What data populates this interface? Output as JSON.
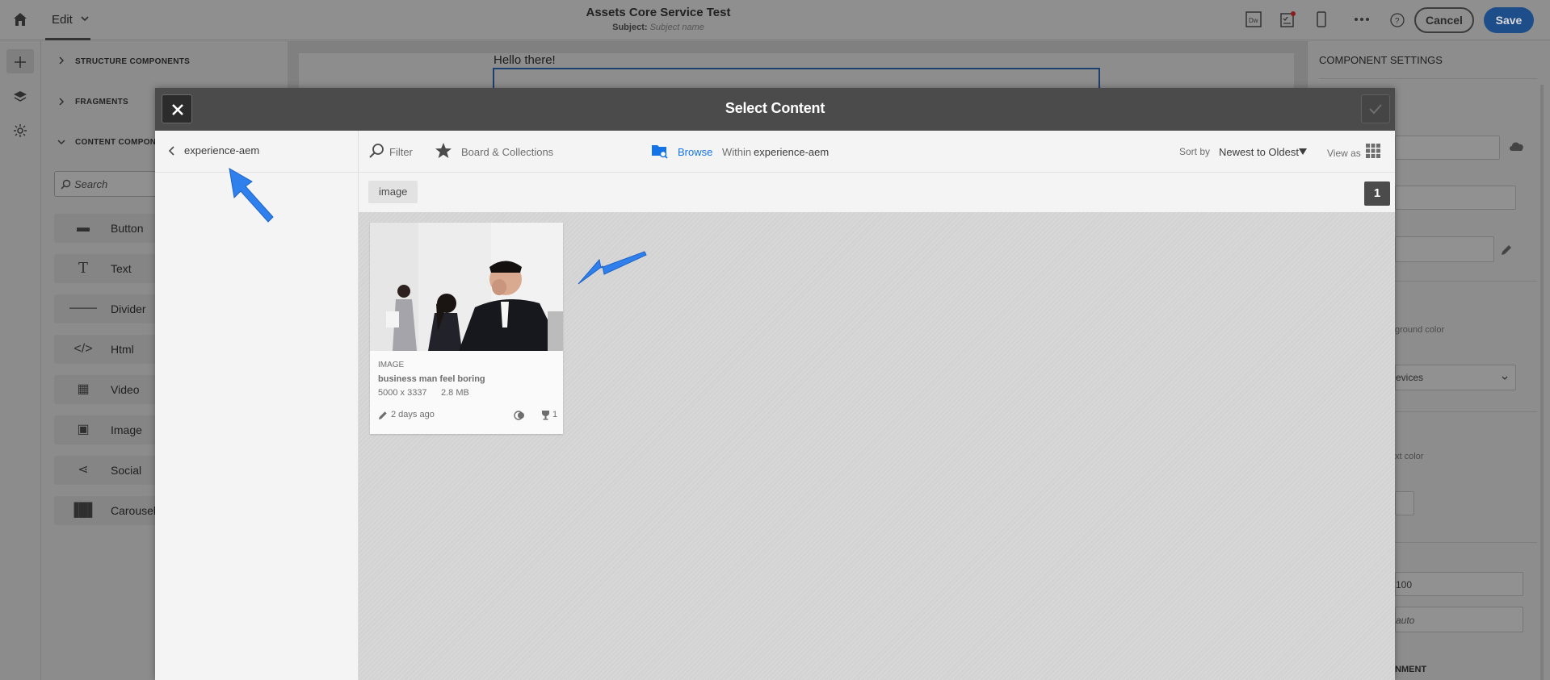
{
  "app": {
    "mode_label": "Edit",
    "title": "Assets Core Service Test",
    "subject_label": "Subject:",
    "subject_placeholder": "Subject name",
    "cancel_label": "Cancel",
    "save_label": "Save"
  },
  "left_panel": {
    "sections": [
      {
        "label": "STRUCTURE COMPONENTS",
        "expanded": false
      },
      {
        "label": "FRAGMENTS",
        "expanded": false
      },
      {
        "label": "CONTENT COMPONENTS",
        "expanded": true
      }
    ],
    "search_placeholder": "Search",
    "components": [
      {
        "label": "Button",
        "icon": "button-icon"
      },
      {
        "label": "Text",
        "icon": "text-icon"
      },
      {
        "label": "Divider",
        "icon": "divider-icon"
      },
      {
        "label": "Html",
        "icon": "code-icon"
      },
      {
        "label": "Video",
        "icon": "film-icon"
      },
      {
        "label": "Image",
        "icon": "image-icon"
      },
      {
        "label": "Social",
        "icon": "share-icon"
      },
      {
        "label": "Carousel",
        "icon": "carousel-icon"
      }
    ]
  },
  "canvas": {
    "text": "Hello there!"
  },
  "right_panel": {
    "title": "COMPONENT SETTINGS",
    "fragments": {
      "bg_color": "ground color",
      "devices": "evices",
      "text_color": "xt color",
      "width_value": "100",
      "height_value": "auto",
      "alignment": "NMENT"
    }
  },
  "modal": {
    "title": "Select Content",
    "breadcrumb": "experience-aem",
    "toolbar": {
      "filter_label": "Filter",
      "collections_label": "Board & Collections",
      "browse_label": "Browse",
      "within_label": "Within",
      "within_value": "experience-aem",
      "sort_label": "Sort by",
      "sort_value": "Newest to Oldest",
      "view_label": "View as"
    },
    "filter_tag": "image",
    "page_count": "1",
    "card": {
      "type": "IMAGE",
      "title": "business man feel boring",
      "dimensions": "5000 x 3337",
      "size": "2.8 MB",
      "modified": "2 days ago",
      "usage_count": "1"
    }
  },
  "colors": {
    "accent": "#1d4e89",
    "annotation_arrow": "#2f80ed",
    "browse_active": "#1473e6"
  }
}
